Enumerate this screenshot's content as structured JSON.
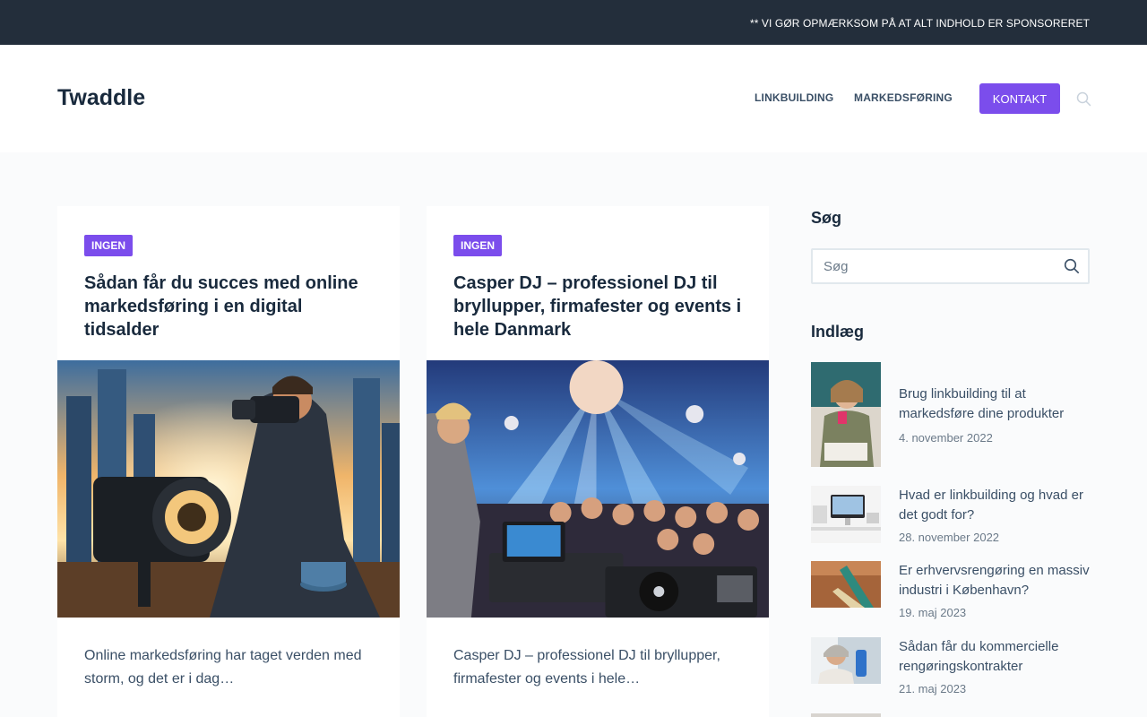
{
  "topbar": {
    "notice": "** VI GØR OPMÆRKSOM PÅ AT ALT INDHOLD ER SPONSORERET"
  },
  "header": {
    "logo": "Twaddle",
    "nav": [
      {
        "label": "LINKBUILDING"
      },
      {
        "label": "MARKEDSFØRING"
      }
    ],
    "cta_label": "KONTAKT"
  },
  "cards": [
    {
      "category": "INGEN",
      "title": "Sådan får du succes med online markedsføring i en digital tidsalder",
      "excerpt": "Online markedsføring har taget verden med storm, og det er i dag…",
      "image_icon": "photographer-camera-image"
    },
    {
      "category": "INGEN",
      "title": "Casper DJ – professionel DJ til bryllupper, firmafester og events i hele Danmark",
      "excerpt": "Casper DJ – professionel DJ til bryllupper, firmafester og events i hele…",
      "image_icon": "dj-party-image"
    }
  ],
  "sidebar": {
    "search_heading": "Søg",
    "search_placeholder": "Søg",
    "posts_heading": "Indlæg",
    "posts": [
      {
        "title": "Brug linkbuilding til at markedsføre dine produkter",
        "date": "4. november 2022"
      },
      {
        "title": "Hvad er linkbuilding og hvad er det godt for?",
        "date": "28. november 2022"
      },
      {
        "title": "Er erhvervsrengøring en massiv industri i København?",
        "date": "19. maj 2023"
      },
      {
        "title": "Sådan får du kommercielle rengøringskontrakter",
        "date": "21. maj 2023"
      }
    ]
  },
  "colors": {
    "accent": "#7b4dec",
    "topbar": "#232e3b",
    "heading": "#192a3d",
    "text": "#3a4f66"
  }
}
